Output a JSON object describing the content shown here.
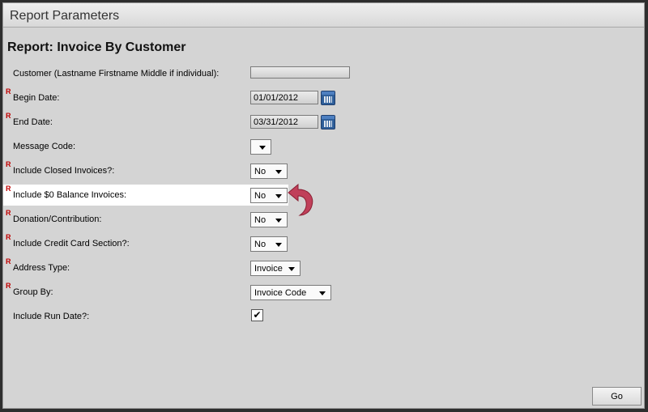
{
  "window": {
    "title": "Report Parameters"
  },
  "report": {
    "title": "Report: Invoice By Customer"
  },
  "required_marker": "R",
  "fields": {
    "customer": {
      "label": "Customer (Lastname Firstname Middle if individual):",
      "value": ""
    },
    "begin_date": {
      "label": "Begin Date:",
      "value": "01/01/2012"
    },
    "end_date": {
      "label": "End Date:",
      "value": "03/31/2012"
    },
    "message_code": {
      "label": "Message Code:",
      "value": ""
    },
    "include_closed": {
      "label": "Include Closed Invoices?:",
      "value": "No"
    },
    "include_zero_balance": {
      "label": "Include $0 Balance Invoices:",
      "value": "No"
    },
    "donation": {
      "label": "Donation/Contribution:",
      "value": "No"
    },
    "include_credit_card": {
      "label": "Include Credit Card Section?:",
      "value": "No"
    },
    "address_type": {
      "label": "Address Type:",
      "value": "Invoice"
    },
    "group_by": {
      "label": "Group By:",
      "value": "Invoice Code"
    },
    "include_run_date": {
      "label": "Include Run Date?:",
      "checked": true,
      "check_glyph": "✔"
    }
  },
  "buttons": {
    "go": "Go"
  },
  "icons": {
    "calendar": "calendar-icon",
    "pointer": "curved-arrow-icon"
  },
  "colors": {
    "required": "#c00000",
    "highlight": "#ffffff",
    "pointer_arrow": "#c0405a"
  }
}
